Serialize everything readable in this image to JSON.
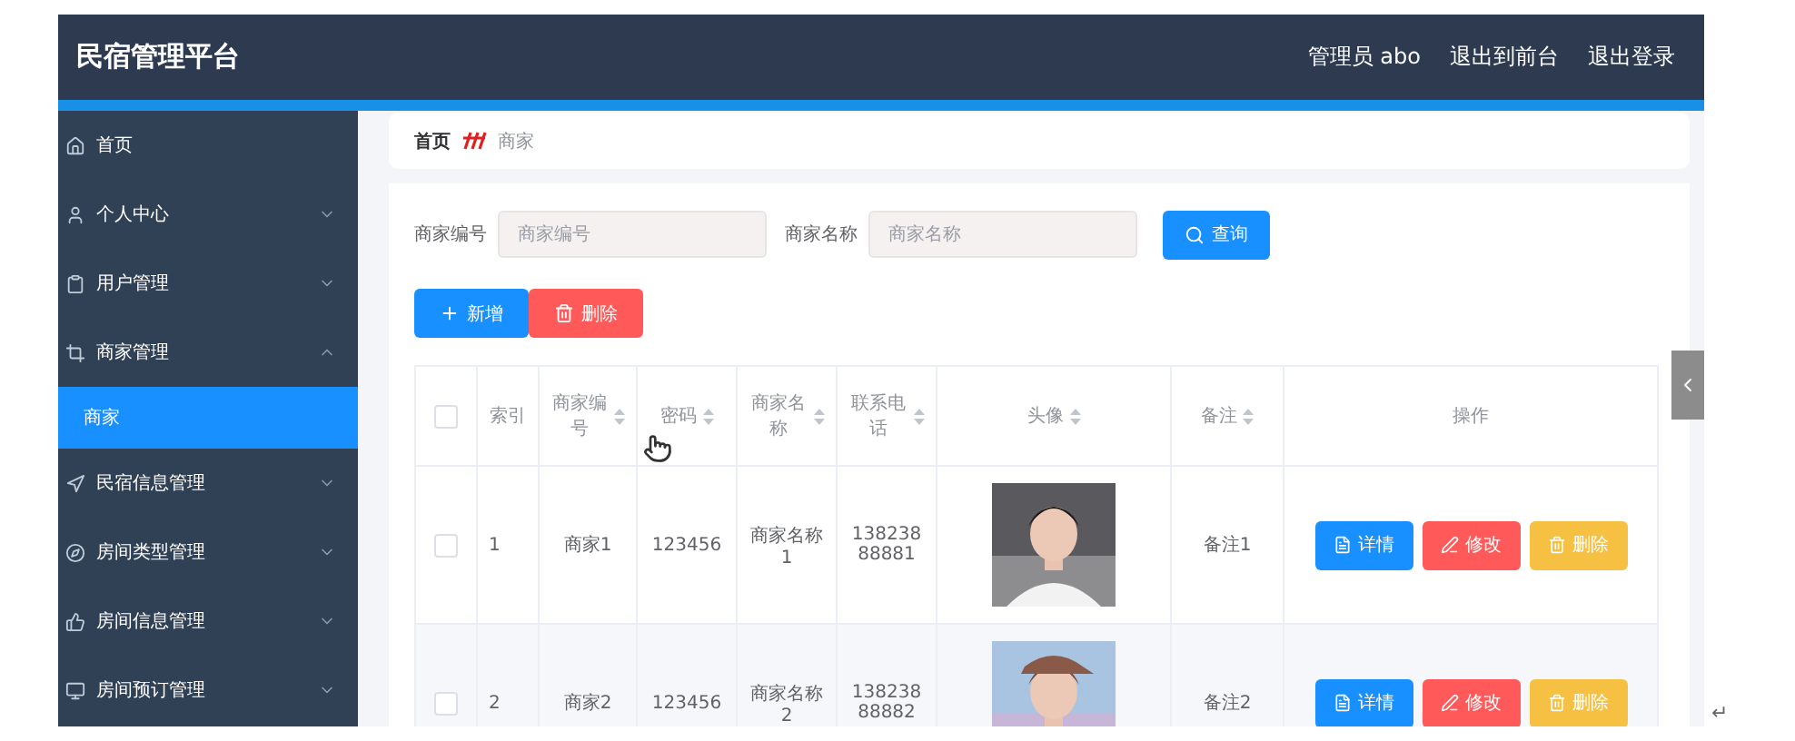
{
  "header": {
    "title": "民宿管理平台",
    "links": [
      "管理员 abo",
      "退出到前台",
      "退出登录"
    ]
  },
  "sidebar": {
    "items": [
      {
        "label": "首页",
        "has_children": false
      },
      {
        "label": "个人中心",
        "has_children": true,
        "expanded": false
      },
      {
        "label": "用户管理",
        "has_children": true,
        "expanded": false
      },
      {
        "label": "商家管理",
        "has_children": true,
        "expanded": true,
        "children": [
          {
            "label": "商家",
            "selected": true
          }
        ]
      },
      {
        "label": "民宿信息管理",
        "has_children": true,
        "expanded": false
      },
      {
        "label": "房间类型管理",
        "has_children": true,
        "expanded": false
      },
      {
        "label": "房间信息管理",
        "has_children": true,
        "expanded": false
      },
      {
        "label": "房间预订管理",
        "has_children": true,
        "expanded": false
      }
    ]
  },
  "breadcrumb": [
    "首页",
    "商家"
  ],
  "search": {
    "fields": [
      {
        "label": "商家编号",
        "placeholder": "商家编号"
      },
      {
        "label": "商家名称",
        "placeholder": "商家名称"
      }
    ],
    "button": "查询"
  },
  "actions": [
    {
      "kind": "add",
      "label": "新增"
    },
    {
      "kind": "delete",
      "label": "删除"
    }
  ],
  "table": {
    "all_checked": false,
    "columns": [
      {
        "label": "索引",
        "sortable": false
      },
      {
        "label": "商家编号",
        "sortable": true
      },
      {
        "label": "密码",
        "sortable": true
      },
      {
        "label": "商家名称",
        "sortable": true
      },
      {
        "label": "联系电话",
        "sortable": true
      },
      {
        "label": "头像",
        "sortable": true
      },
      {
        "label": "备注",
        "sortable": true
      },
      {
        "label": "操作",
        "sortable": false
      }
    ],
    "rows": [
      {
        "checked": false,
        "index": "1",
        "code": "商家1",
        "password": "123456",
        "name": "商家名称1",
        "phone": "13823888881",
        "note": "备注1",
        "buttons": [
          {
            "kind": "detail",
            "label": "详情"
          },
          {
            "kind": "edit",
            "label": "修改"
          },
          {
            "kind": "delete",
            "label": "删除"
          }
        ]
      },
      {
        "checked": false,
        "index": "2",
        "code": "商家2",
        "password": "123456",
        "name": "商家名称2",
        "phone": "13823888882",
        "note": "备注2",
        "buttons": [
          {
            "kind": "detail",
            "label": "详情"
          },
          {
            "kind": "edit",
            "label": "修改"
          },
          {
            "kind": "delete",
            "label": "删除"
          }
        ]
      }
    ]
  },
  "paragraph_mark": "↵"
}
